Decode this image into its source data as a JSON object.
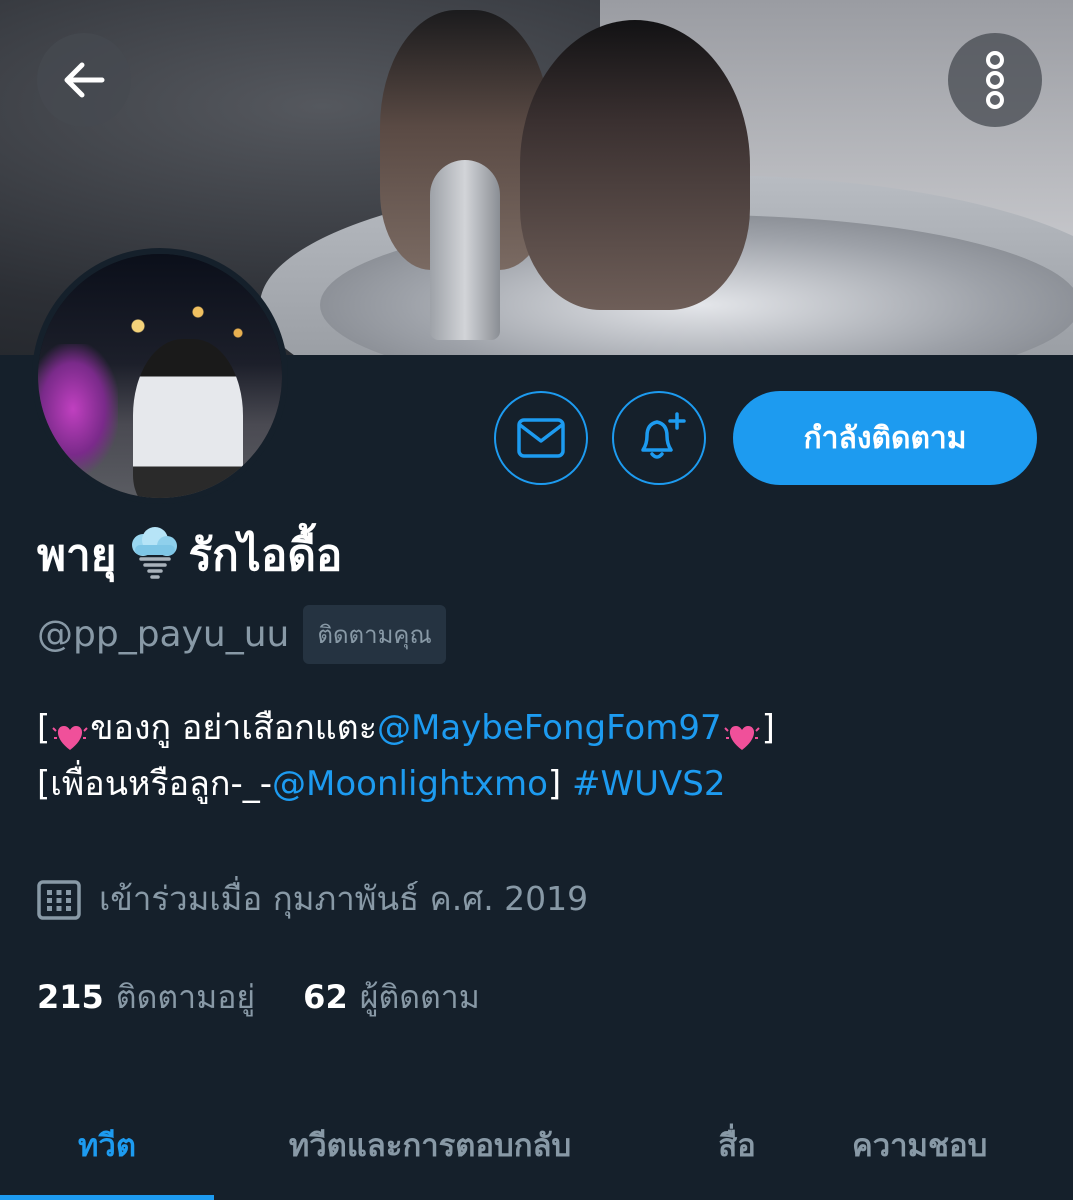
{
  "profile": {
    "display_name": "พายุ",
    "display_name_suffix": "รักไอดื้อ",
    "handle": "@pp_payu_uu",
    "follows_you_badge": "ติดตามคุณ",
    "bio": {
      "line1_open": "[",
      "line1_text": "ของกู อย่าเสือกแตะ",
      "line1_mention": "@MaybeFongFom97",
      "line1_close": "]",
      "line2_text": "[เพื่อนหรือลูก-_-",
      "line2_mention": "@Moonlightxmo",
      "line2_close": "]",
      "line2_hashtag": "#WUVS2"
    },
    "joined": "เข้าร่วมเมื่อ กุมภาพันธ์ ค.ศ. 2019",
    "following_count": "215",
    "following_label": "ติดตามอยู่",
    "followers_count": "62",
    "followers_label": "ผู้ติดตาม"
  },
  "actions": {
    "follow_label": "กำลังติดตาม"
  },
  "tabs": [
    {
      "label": "ทวีต",
      "active": true
    },
    {
      "label": "ทวีตและการตอบกลับ",
      "active": false
    },
    {
      "label": "สื่อ",
      "active": false
    },
    {
      "label": "ความชอบ",
      "active": false
    }
  ],
  "icons": {
    "back": "arrow-left-icon",
    "more": "more-vertical-icon",
    "message": "envelope-icon",
    "notify": "bell-plus-icon",
    "calendar": "calendar-icon",
    "storm": "tornado-cloud-emoji",
    "heart": "sparkling-heart-emoji"
  },
  "colors": {
    "background": "#15202b",
    "accent": "#1d9bf0",
    "secondary_text": "#8899a6",
    "badge_bg": "#253341"
  }
}
